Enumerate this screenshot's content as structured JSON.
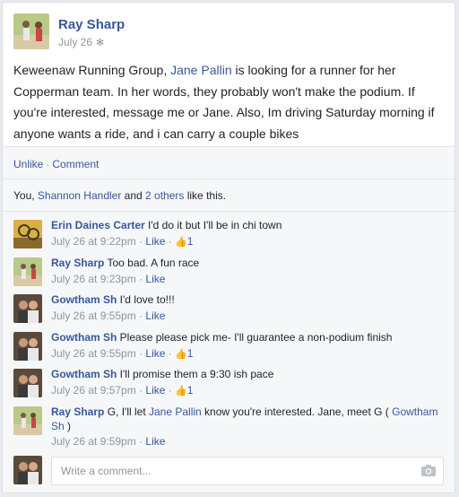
{
  "post": {
    "author": "Ray Sharp",
    "date": "July 26",
    "privacy_icon": "gear-icon",
    "text_part1": "Keweenaw Running Group, ",
    "tag": "Jane Pallin",
    "text_part2": " is looking for a runner for her Copperman team. In her words, they probably won't make the podium. If you're interested, message me or Jane. Also, Im driving Saturday morning if anyone wants a ride, and i can carry a couple bikes"
  },
  "actions": {
    "unlike": "Unlike",
    "separator": "·",
    "comment": "Comment"
  },
  "likes": {
    "prefix": "You, ",
    "person": "Shannon Handler",
    "middle": " and ",
    "others": "2 others",
    "suffix": " like this."
  },
  "comments": [
    {
      "author": "Erin Daines Carter",
      "text": " I'd do it but I'll be in chi town",
      "time": "July 26 at 9:22pm",
      "like": "Like",
      "count": "1"
    },
    {
      "author": "Ray Sharp",
      "text": " Too bad. A fun race",
      "time": "July 26 at 9:23pm",
      "like": "Like"
    },
    {
      "author": "Gowtham Sh",
      "text": " I'd love to!!!",
      "time": "July 26 at 9:55pm",
      "like": "Like"
    },
    {
      "author": "Gowtham Sh",
      "text": " Please please pick me- I'll guarantee a non-podium finish",
      "time": "July 26 at 9:55pm",
      "like": "Like",
      "count": "1"
    },
    {
      "author": "Gowtham Sh",
      "text": " I'll promise them a 9:30 ish pace",
      "time": "July 26 at 9:57pm",
      "like": "Like",
      "count": "1"
    },
    {
      "author": "Ray Sharp",
      "text_a": " G, I'll let ",
      "tag1": "Jane Pallin",
      "text_b": " know you're interested. Jane, meet G ( ",
      "tag2": "Gowtham Sh",
      "text_c": " )",
      "time": "July 26 at 9:59pm",
      "like": "Like"
    }
  ],
  "composer": {
    "placeholder": "Write a comment...",
    "icon": "camera-icon"
  },
  "colors": {
    "link": "#365899",
    "meta": "#90949c",
    "footer": "#f6f7f9"
  }
}
